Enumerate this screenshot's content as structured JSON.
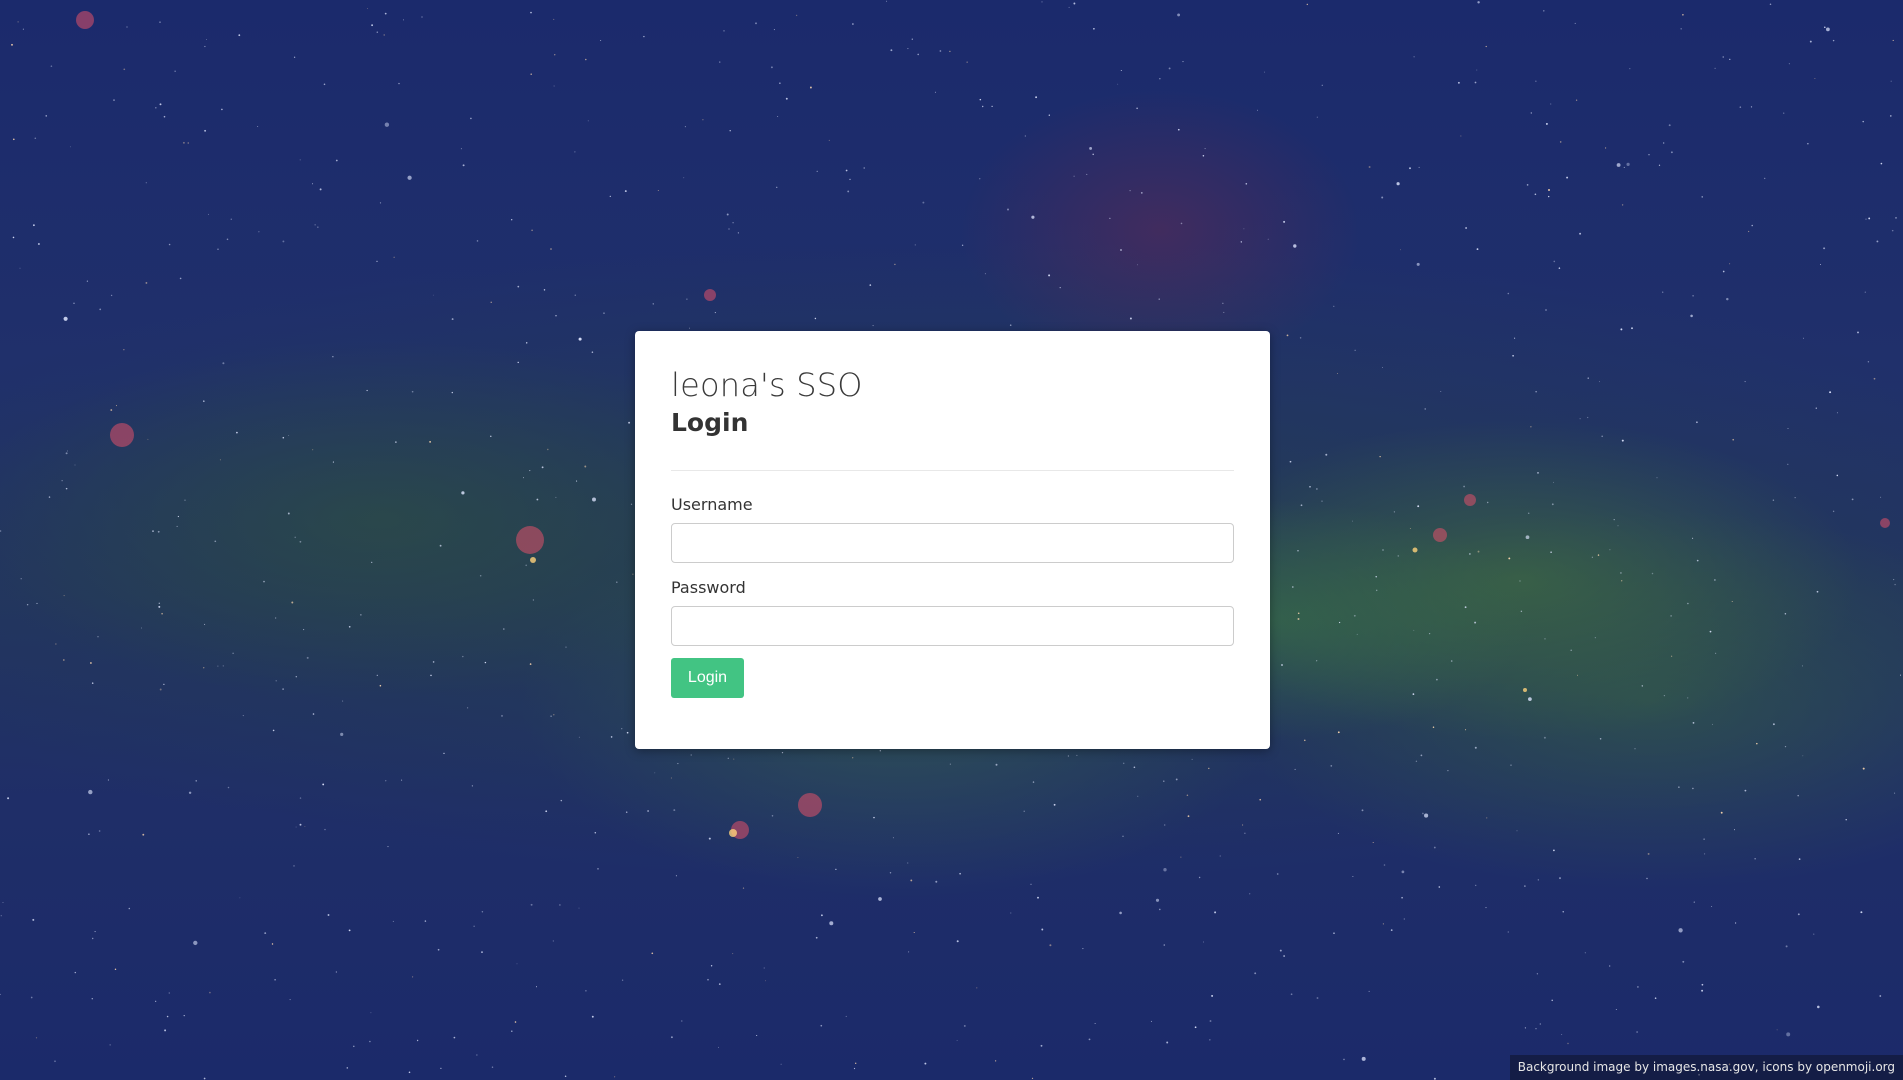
{
  "app": {
    "site_title": "leona's SSO",
    "page_title": "Login"
  },
  "form": {
    "username_label": "Username",
    "username_value": "",
    "password_label": "Password",
    "password_value": "",
    "submit_label": "Login"
  },
  "footer": {
    "attribution": "Background image by images.nasa.gov, icons by openmoji.org"
  },
  "colors": {
    "accent": "#42c483",
    "background": "#1e2e6a",
    "card": "#ffffff"
  }
}
